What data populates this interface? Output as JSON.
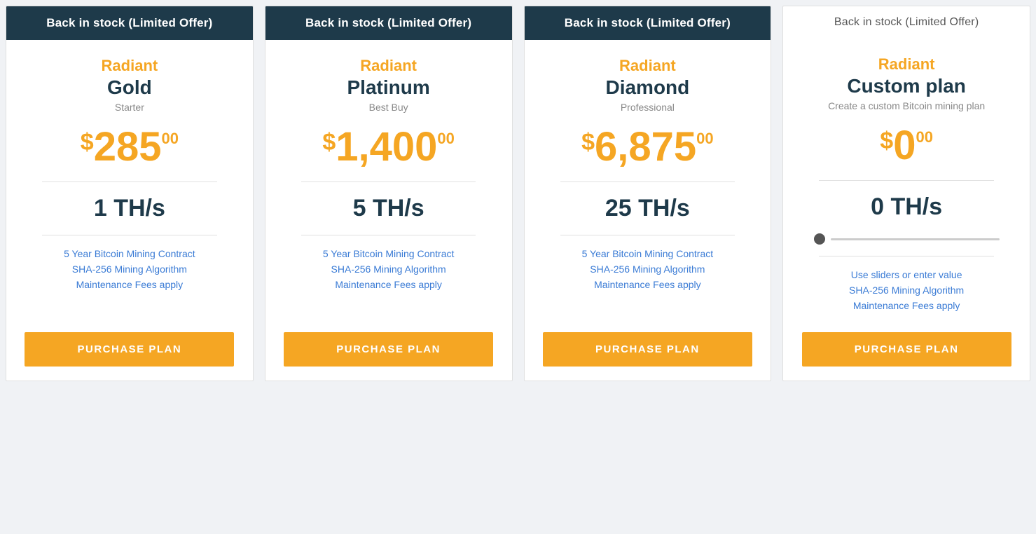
{
  "cards": [
    {
      "id": "gold",
      "header": "Back in stock (Limited Offer)",
      "header_style": "filled",
      "brand": "Radiant",
      "name": "Gold",
      "subtitle": "Starter",
      "price_dollar": "$",
      "price_main": "285",
      "price_cents": "00",
      "ths": "1 TH/s",
      "features": [
        "5 Year Bitcoin Mining Contract",
        "SHA-256 Mining Algorithm",
        "Maintenance Fees apply"
      ],
      "button_label": "PURCHASE PLAN"
    },
    {
      "id": "platinum",
      "header": "Back in stock (Limited Offer)",
      "header_style": "filled",
      "brand": "Radiant",
      "name": "Platinum",
      "subtitle": "Best Buy",
      "price_dollar": "$",
      "price_main": "1,400",
      "price_cents": "00",
      "ths": "5 TH/s",
      "features": [
        "5 Year Bitcoin Mining Contract",
        "SHA-256 Mining Algorithm",
        "Maintenance Fees apply"
      ],
      "button_label": "PURCHASE PLAN"
    },
    {
      "id": "diamond",
      "header": "Back in stock (Limited Offer)",
      "header_style": "filled",
      "brand": "Radiant",
      "name": "Diamond",
      "subtitle": "Professional",
      "price_dollar": "$",
      "price_main": "6,875",
      "price_cents": "00",
      "ths": "25 TH/s",
      "features": [
        "5 Year Bitcoin Mining Contract",
        "SHA-256 Mining Algorithm",
        "Maintenance Fees apply"
      ],
      "button_label": "PURCHASE PLAN"
    },
    {
      "id": "custom",
      "header": "Back in stock (Limited Offer)",
      "header_style": "plain",
      "brand": "Radiant",
      "name": "Custom plan",
      "subtitle": "Create a custom Bitcoin mining plan",
      "price_dollar": "$",
      "price_main": "0",
      "price_cents": "00",
      "ths": "0 TH/s",
      "has_slider": true,
      "features": [
        "Use sliders or enter value",
        "SHA-256 Mining Algorithm",
        "Maintenance Fees apply"
      ],
      "button_label": "PURCHASE PLAN"
    }
  ]
}
